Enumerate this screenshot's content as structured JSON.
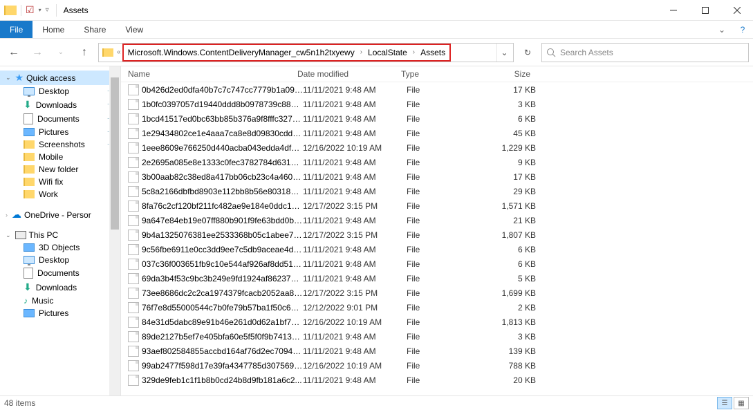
{
  "window": {
    "title": "Assets"
  },
  "menubar": {
    "file": "File",
    "home": "Home",
    "share": "Share",
    "view": "View"
  },
  "address": {
    "crumb1": "Microsoft.Windows.ContentDeliveryManager_cw5n1h2txyewy",
    "crumb2": "LocalState",
    "crumb3": "Assets"
  },
  "search": {
    "placeholder": "Search Assets"
  },
  "columns": {
    "name": "Name",
    "date": "Date modified",
    "type": "Type",
    "size": "Size"
  },
  "sidebar": {
    "quick": "Quick access",
    "desktop": "Desktop",
    "downloads": "Downloads",
    "documents": "Documents",
    "pictures": "Pictures",
    "screenshots": "Screenshots",
    "mobile": "Mobile",
    "newfolder": "New folder",
    "wififix": "Wifi fix",
    "work": "Work",
    "onedrive": "OneDrive - Persor",
    "thispc": "This PC",
    "objects3d": "3D Objects",
    "desktop2": "Desktop",
    "documents2": "Documents",
    "downloads2": "Downloads",
    "music": "Music",
    "pictures2": "Pictures"
  },
  "files": [
    {
      "name": "0b426d2ed0dfa40b7c7c747cc7779b1a09f...",
      "date": "11/11/2021 9:48 AM",
      "type": "File",
      "size": "17 KB"
    },
    {
      "name": "1b0fc0397057d19440ddd8b0978739c8877...",
      "date": "11/11/2021 9:48 AM",
      "type": "File",
      "size": "3 KB"
    },
    {
      "name": "1bcd41517ed0bc63bb85b376a9f8fffc3273...",
      "date": "11/11/2021 9:48 AM",
      "type": "File",
      "size": "6 KB"
    },
    {
      "name": "1e29434802ce1e4aaa7ca8e8d09830cdd33...",
      "date": "11/11/2021 9:48 AM",
      "type": "File",
      "size": "45 KB"
    },
    {
      "name": "1eee8609e766250d440acba043edda4df06...",
      "date": "12/16/2022 10:19 AM",
      "type": "File",
      "size": "1,229 KB"
    },
    {
      "name": "2e2695a085e8e1333c0fec3782784d631b0a...",
      "date": "11/11/2021 9:48 AM",
      "type": "File",
      "size": "9 KB"
    },
    {
      "name": "3b00aab82c38ed8a417bb06cb23c4a4601e...",
      "date": "11/11/2021 9:48 AM",
      "type": "File",
      "size": "17 KB"
    },
    {
      "name": "5c8a2166dbfbd8903e112bb8b56e80318bb...",
      "date": "11/11/2021 9:48 AM",
      "type": "File",
      "size": "29 KB"
    },
    {
      "name": "8fa76c2cf120bf211fc482ae9e184e0ddc1c3...",
      "date": "12/17/2022 3:15 PM",
      "type": "File",
      "size": "1,571 KB"
    },
    {
      "name": "9a647e84eb19e07ff880b901f9fe63bdd0b3...",
      "date": "11/11/2021 9:48 AM",
      "type": "File",
      "size": "21 KB"
    },
    {
      "name": "9b4a1325076381ee2533368b05c1abee714...",
      "date": "12/17/2022 3:15 PM",
      "type": "File",
      "size": "1,807 KB"
    },
    {
      "name": "9c56fbe6911e0cc3dd9ee7c5db9aceae4d8...",
      "date": "11/11/2021 9:48 AM",
      "type": "File",
      "size": "6 KB"
    },
    {
      "name": "037c36f003651fb9c10e544af926af8dd51fa...",
      "date": "11/11/2021 9:48 AM",
      "type": "File",
      "size": "6 KB"
    },
    {
      "name": "69da3b4f53c9bc3b249e9fd1924af86237a875...",
      "date": "11/11/2021 9:48 AM",
      "type": "File",
      "size": "5 KB"
    },
    {
      "name": "73ee8686dc2c2ca1974379fcacb2052aa83f...",
      "date": "12/17/2022 3:15 PM",
      "type": "File",
      "size": "1,699 KB"
    },
    {
      "name": "76f7e8d55000544c7b0fe79b57ba1f50c6e2...",
      "date": "12/12/2022 9:01 PM",
      "type": "File",
      "size": "2 KB"
    },
    {
      "name": "84e31d5dabc89e91b46e261d0d62a1bf7227...",
      "date": "12/16/2022 10:19 AM",
      "type": "File",
      "size": "1,813 KB"
    },
    {
      "name": "89de2127b5ef7e405bfa60e5f5f0f9b7413e0...",
      "date": "11/11/2021 9:48 AM",
      "type": "File",
      "size": "3 KB"
    },
    {
      "name": "93aef802584855accbd164af76d2ec709425...",
      "date": "11/11/2021 9:48 AM",
      "type": "File",
      "size": "139 KB"
    },
    {
      "name": "99ab2477f598d17e39fa4347785d3075693e...",
      "date": "12/16/2022 10:19 AM",
      "type": "File",
      "size": "788 KB"
    },
    {
      "name": "329de9feb1c1f1b8b0cd24b8d9fb181a6c2...",
      "date": "11/11/2021 9:48 AM",
      "type": "File",
      "size": "20 KB"
    }
  ],
  "status": {
    "count": "48 items"
  }
}
